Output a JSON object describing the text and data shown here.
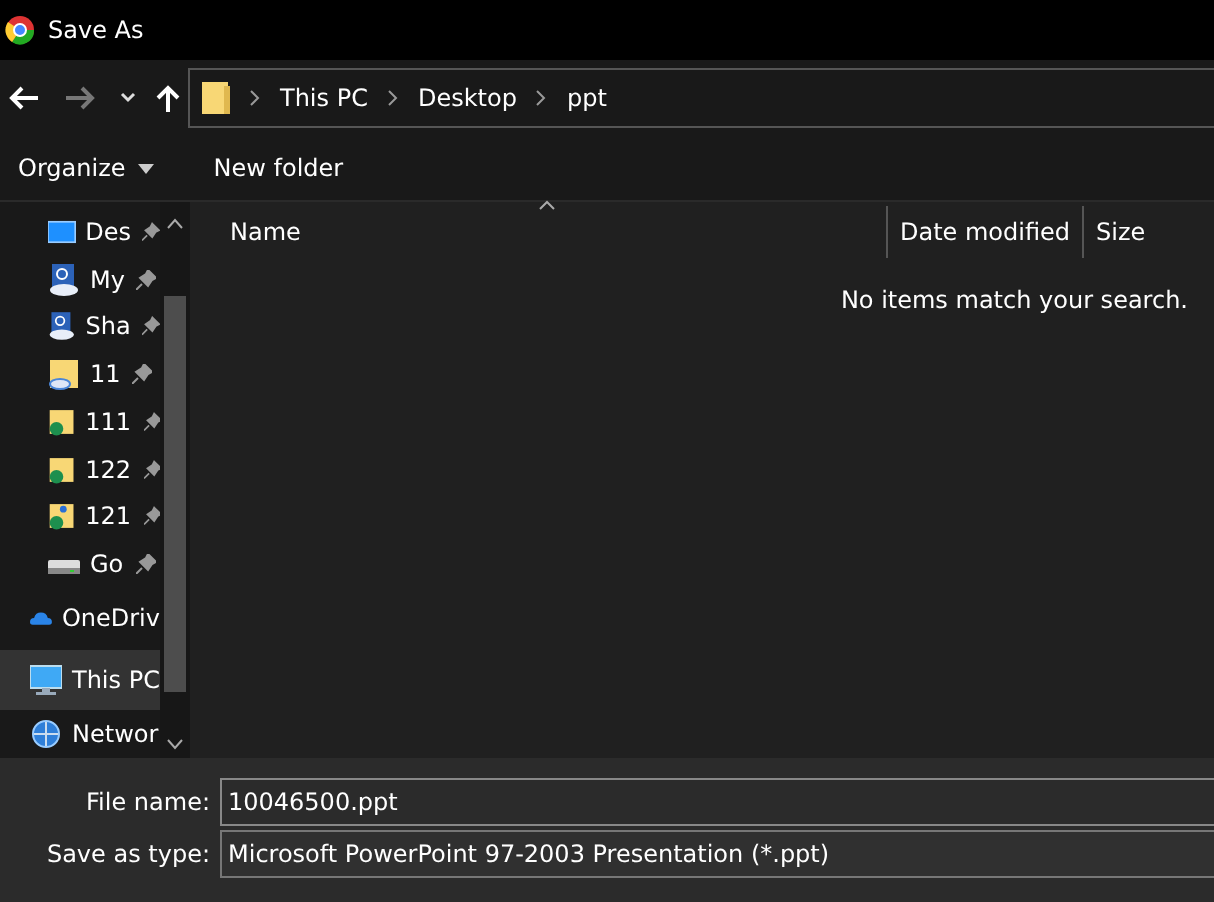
{
  "window": {
    "title": "Save As"
  },
  "navigation": {
    "back_enabled": true,
    "forward_enabled": false
  },
  "breadcrumb": [
    "This PC",
    "Desktop",
    "ppt"
  ],
  "toolbar": {
    "organize": "Organize",
    "new_folder": "New folder"
  },
  "sidebar": {
    "items": [
      {
        "label": "Des",
        "kind": "desktop",
        "pinned": true,
        "selected": false
      },
      {
        "label": "My",
        "kind": "clouddoc",
        "pinned": true,
        "selected": false
      },
      {
        "label": "Sha",
        "kind": "clouddoc",
        "pinned": true,
        "selected": false
      },
      {
        "label": "11",
        "kind": "cloudfolder",
        "pinned": true,
        "selected": false
      },
      {
        "label": "111",
        "kind": "syncfolder",
        "pinned": true,
        "selected": false
      },
      {
        "label": "122",
        "kind": "syncfolder",
        "pinned": true,
        "selected": false
      },
      {
        "label": "121",
        "kind": "sharedfolder",
        "pinned": true,
        "selected": false
      },
      {
        "label": "Go",
        "kind": "drive",
        "pinned": true,
        "selected": false
      },
      {
        "label": "OneDriv",
        "kind": "onedrive",
        "pinned": false,
        "selected": false
      },
      {
        "label": "This PC",
        "kind": "pc",
        "pinned": false,
        "selected": true
      },
      {
        "label": "Networ",
        "kind": "network",
        "pinned": false,
        "selected": false
      }
    ]
  },
  "file_list": {
    "columns": [
      {
        "label": "Name",
        "sorted": true
      },
      {
        "label": "Date modified",
        "sorted": false
      },
      {
        "label": "Size",
        "sorted": false
      }
    ],
    "empty_message": "No items match your search."
  },
  "form": {
    "fields": [
      {
        "label": "File name:",
        "value": "10046500.ppt",
        "kind": "text"
      },
      {
        "label": "Save as type:",
        "value": "Microsoft PowerPoint 97-2003 Presentation (*.ppt)",
        "kind": "dropdown"
      }
    ]
  }
}
